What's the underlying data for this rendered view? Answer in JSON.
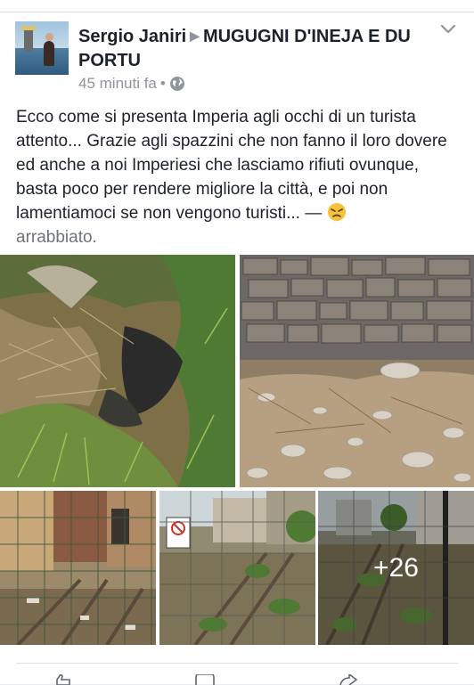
{
  "post": {
    "author": "Sergio Janiri",
    "group": "MUGUGNI D'INEJA E DU PORTU",
    "time": "45 minuti fa",
    "separator": "•",
    "text": "Ecco come si presenta Imperia agli occhi di un turista attento... Grazie agli spazzini che non fanno il loro dovere ed anche a noi Imperiesi che lasciamo rifiuti ovunque, basta poco per rendere migliore la città, e poi non lamentiamoci se non vengono turisti...",
    "feeling_dash": "—",
    "feeling_label": "arrabbiato.",
    "more_photos": "+26"
  },
  "icons": {
    "globe": "globe-icon",
    "chevron": "chevron-down-icon",
    "arrow": "right-triangle-icon",
    "emoji": "angry-face-icon"
  },
  "colors": {
    "text": "#1d2129",
    "secondary": "#90949c",
    "emoji": "#f5c33b"
  }
}
